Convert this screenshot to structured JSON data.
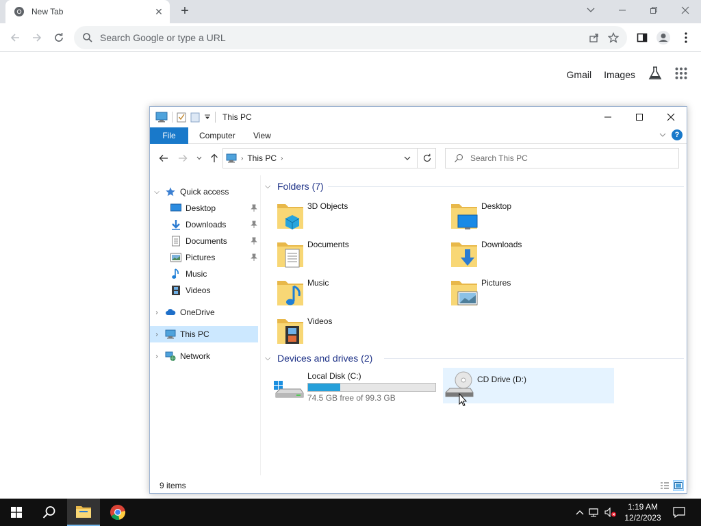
{
  "browser": {
    "tab_title": "New Tab",
    "omnibox_placeholder": "Search Google or type a URL",
    "ntp_links": {
      "gmail": "Gmail",
      "images": "Images"
    }
  },
  "explorer": {
    "title": "This PC",
    "ribbon_tabs": {
      "file": "File",
      "computer": "Computer",
      "view": "View"
    },
    "breadcrumb": "This PC",
    "search_placeholder": "Search This PC",
    "nav": {
      "quick_access": "Quick access",
      "desktop": "Desktop",
      "downloads": "Downloads",
      "documents": "Documents",
      "pictures": "Pictures",
      "music": "Music",
      "videos": "Videos",
      "onedrive": "OneDrive",
      "this_pc": "This PC",
      "network": "Network"
    },
    "folders_header": "Folders (7)",
    "folders": {
      "objects3d": "3D Objects",
      "desktop": "Desktop",
      "documents": "Documents",
      "downloads": "Downloads",
      "music": "Music",
      "pictures": "Pictures",
      "videos": "Videos"
    },
    "devices_header": "Devices and drives (2)",
    "drives": {
      "c_name": "Local Disk (C:)",
      "c_free": "74.5 GB free of 99.3 GB",
      "c_used_fraction": 0.25,
      "d_name": "CD Drive (D:)"
    },
    "status": "9 items"
  },
  "taskbar": {
    "time": "1:19 AM",
    "date": "12/2/2023"
  },
  "colors": {
    "accent": "#1979ca",
    "selection": "#cce8ff",
    "drive_fill": "#26a0da",
    "folder_yellow": "#f8d775"
  }
}
